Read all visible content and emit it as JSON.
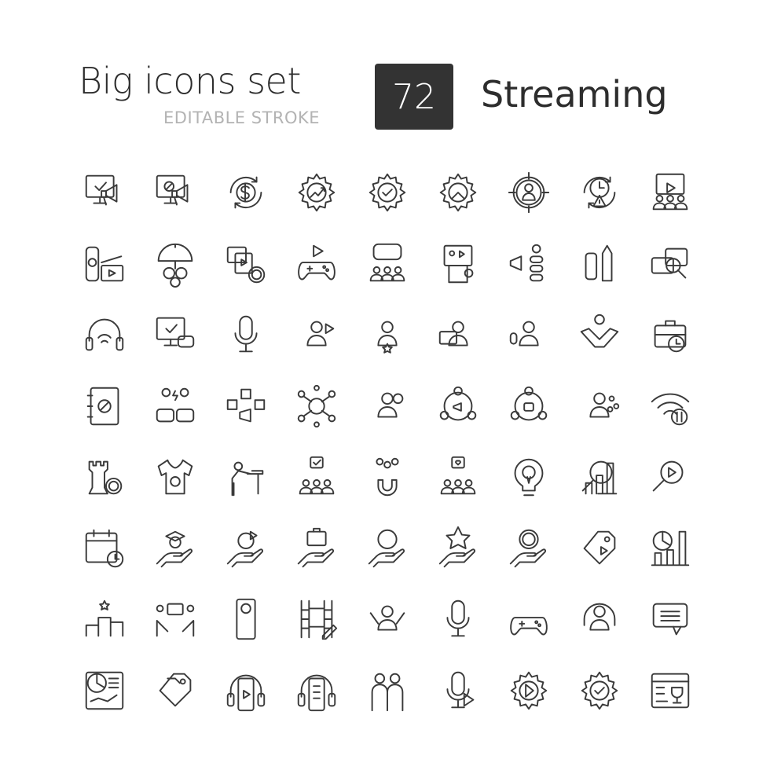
{
  "header": {
    "title": "Big icons set",
    "subtitle": "EDITABLE STROKE",
    "count": "72",
    "topic": "Streaming"
  },
  "colors": {
    "badge_bg": "#333333",
    "text": "#2d2d2d",
    "subtitle": "#b3b3b3",
    "stroke": "#3a3a3a"
  },
  "icons": [
    "monitor-megaphone-check-icon",
    "monitor-megaphone-blocked-icon",
    "dollar-cycle-icon",
    "gear-growth-icon",
    "gear-check-icon",
    "gear-pie-icon",
    "target-person-icon",
    "clock-warning-cycle-icon",
    "video-audience-icon",
    "remote-clapperboard-icon",
    "umbrella-insurance-icon",
    "media-files-gear-icon",
    "gamepad-play-icon",
    "gamepad-team-icon",
    "online-course-icon",
    "megaphone-people-icon",
    "drinks-bottles-icon",
    "chat-search-icon",
    "headphones-wireless-icon",
    "monitor-gamepad-check-icon",
    "podcast-microphone-icon",
    "streamer-play-icon",
    "person-star-icon",
    "person-headset-computer-icon",
    "person-headset-microphone-icon",
    "handshake-dollar-icon",
    "briefcase-clock-icon",
    "notebook-blocked-icon",
    "gamers-versus-icon",
    "social-media-megaphone-icon",
    "dollar-network-icon",
    "support-gear-icon",
    "community-megaphone-icon",
    "community-chat-icon",
    "speaker-audience-icon",
    "wifi-transfer-icon",
    "chess-rook-gear-icon",
    "tshirt-blocked-icon",
    "tired-worker-icon",
    "team-approval-icon",
    "audience-magnet-icon",
    "team-heart-icon",
    "lightbulb-gear-pencil-icon",
    "search-idea-chart-icon",
    "search-video-chart-icon",
    "calendar-clock-icon",
    "hand-education-video-icon",
    "hand-music-play-icon",
    "hand-briefcase-icon",
    "hand-dollar-icon",
    "hand-star-play-icon",
    "hand-dollar-cycle-icon",
    "price-tag-video-icon",
    "pie-bar-chart-icon",
    "podium-ranking-icon",
    "esports-players-icon",
    "phone-emoji-reaction-icon",
    "film-edit-icon",
    "streamer-cheering-icon",
    "microphone-topics-icon",
    "multiple-gamepads-icon",
    "woman-headset-icon",
    "chat-bubble-icon",
    "dashboard-report-icon",
    "price-tags-icon",
    "headphones-phone-play-icon",
    "headphones-phone-checklist-icon",
    "people-greeting-icon",
    "microphone-play-icon",
    "lightbulb-gear-play-icon",
    "lightbulb-gear-check-icon",
    "web-trophy-icon"
  ]
}
